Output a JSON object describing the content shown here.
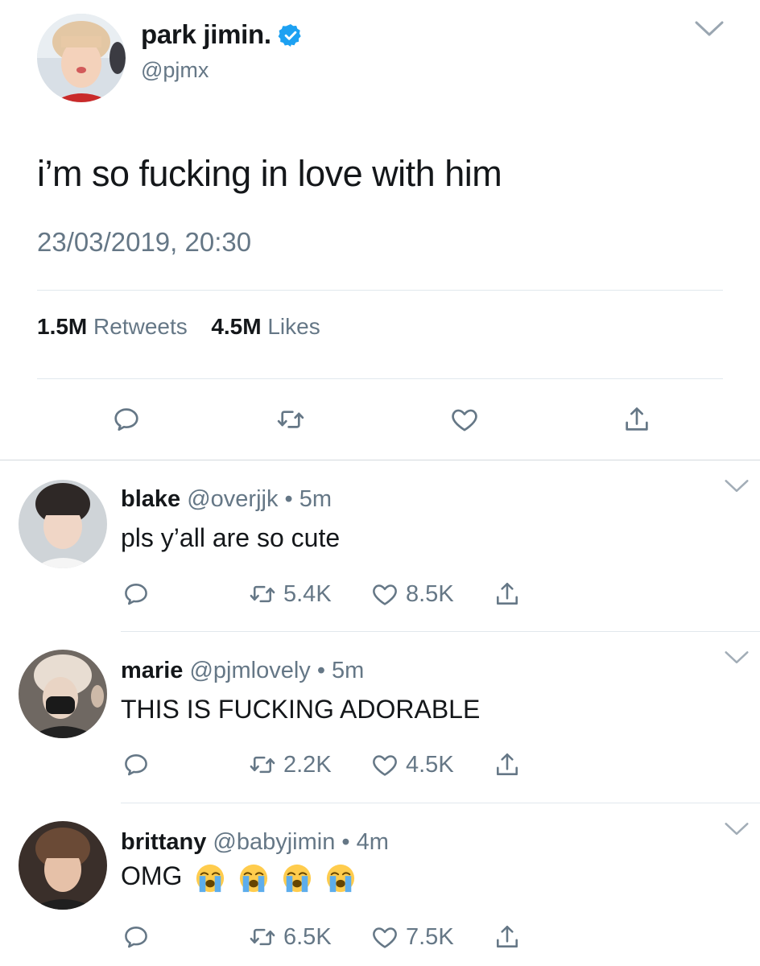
{
  "tweet": {
    "display_name": "park jimin.",
    "handle": "@pjmx",
    "text": "i’m so fucking in love with him",
    "timestamp": "23/03/2019, 20:30",
    "retweets_count": "1.5M",
    "retweets_label": "Retweets",
    "likes_count": "4.5M",
    "likes_label": "Likes",
    "verified": true
  },
  "replies": [
    {
      "name": "blake",
      "meta": "@overjjk • 5m",
      "text": "pls y’all are so cute",
      "retweets": "5.4K",
      "likes": "8.5K"
    },
    {
      "name": "marie",
      "meta": "@pjmlovely • 5m",
      "text": "THIS IS FUCKING ADORABLE",
      "retweets": "2.2K",
      "likes": "4.5K"
    },
    {
      "name": "brittany",
      "meta": "@babyjimin • 4m",
      "text": "OMG",
      "emojis": [
        "loudly-crying-face",
        "loudly-crying-face",
        "loudly-crying-face",
        "loudly-crying-face"
      ],
      "retweets": "6.5K",
      "likes": "7.5K"
    }
  ],
  "icons": {
    "reply": "speech-bubble-icon",
    "retweet": "retweet-icon",
    "like": "heart-icon",
    "share": "share-icon",
    "more": "chevron-down-icon"
  },
  "colors": {
    "text": "#14171a",
    "secondary": "#657786",
    "verified": "#1da1f2",
    "divider": "#e1e8ed"
  }
}
